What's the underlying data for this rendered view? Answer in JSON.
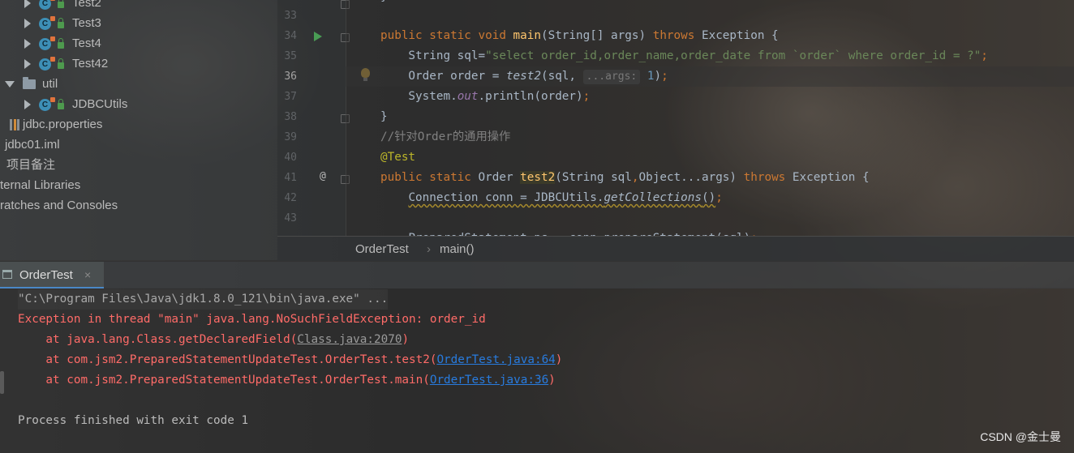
{
  "project_tree": {
    "items": [
      {
        "label": "Test2",
        "kind": "class",
        "expander": "collapsed"
      },
      {
        "label": "Test3",
        "kind": "class",
        "expander": "collapsed"
      },
      {
        "label": "Test4",
        "kind": "class",
        "expander": "collapsed"
      },
      {
        "label": "Test42",
        "kind": "class",
        "expander": "collapsed"
      },
      {
        "label": "util",
        "kind": "package",
        "expander": "expanded"
      },
      {
        "label": "JDBCUtils",
        "kind": "class",
        "expander": "collapsed"
      },
      {
        "label": "jdbc.properties",
        "kind": "properties-file"
      },
      {
        "label": "jdbc01.iml",
        "kind": "module-file"
      },
      {
        "label": "项目备注",
        "kind": "file"
      },
      {
        "label": "ternal Libraries",
        "kind": "node"
      },
      {
        "label": "ratches and Consoles",
        "kind": "node"
      }
    ]
  },
  "editor": {
    "line_numbers": [
      "33",
      "34",
      "35",
      "36",
      "37",
      "38",
      "39",
      "40",
      "41",
      "42",
      "43"
    ],
    "current_line": "36",
    "inlay_hint": "...args:",
    "string_literal": "\"select order_id,order_name,order_date from `order` where order_id = ?\"",
    "comment": "//针对Order的通用操作",
    "annotation": "@Test",
    "gutter_at_symbol": "@"
  },
  "breadcrumb": {
    "class_name": "OrderTest",
    "separator": "›",
    "method_name": "main()"
  },
  "run_panel": {
    "tab_label": "OrderTest",
    "tab_close": "×",
    "lines": {
      "command": "\"C:\\Program Files\\Java\\jdk1.8.0_121\\bin\\java.exe\" ...",
      "exception": "Exception in thread \"main\" java.lang.NoSuchFieldException: order_id",
      "frame1_prefix": "    at java.lang.Class.getDeclaredField(",
      "frame1_link": "Class.java:2070",
      "frame1_suffix": ")",
      "frame2_prefix": "    at com.jsm2.PreparedStatementUpdateTest.OrderTest.test2(",
      "frame2_link": "OrderTest.java:64",
      "frame2_suffix": ")",
      "frame3_prefix": "    at com.jsm2.PreparedStatementUpdateTest.OrderTest.main(",
      "frame3_link": "OrderTest.java:36",
      "frame3_suffix": ")",
      "exit": "Process finished with exit code 1"
    }
  },
  "watermark": "CSDN @金士曼",
  "colors": {
    "keyword": "#cc7832",
    "string": "#6a8759",
    "method_decl": "#ffc66d",
    "error_text": "#ff6b68",
    "link": "#287bde",
    "annotation": "#bbb529"
  }
}
